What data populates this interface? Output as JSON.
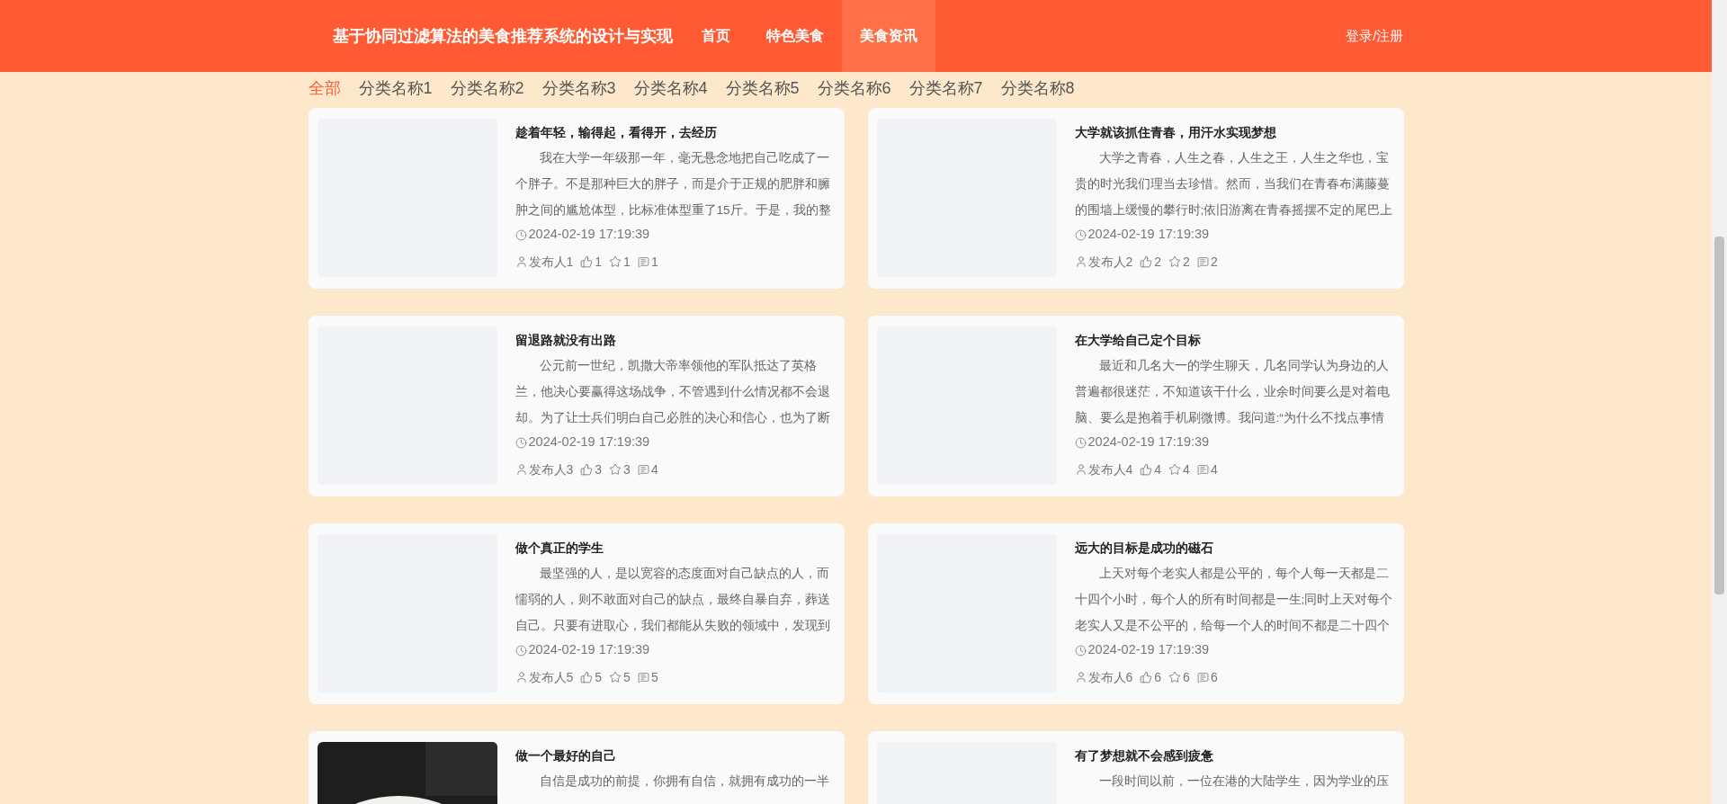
{
  "header": {
    "title": "基于协同过滤算法的美食推荐系统的设计与实现",
    "nav": [
      {
        "label": "首页",
        "selected": false
      },
      {
        "label": "特色美食",
        "selected": false
      },
      {
        "label": "美食资讯",
        "selected": true
      }
    ],
    "login": "登录/注册"
  },
  "categories": [
    {
      "label": "全部",
      "selected": true
    },
    {
      "label": "分类名称1",
      "selected": false
    },
    {
      "label": "分类名称2",
      "selected": false
    },
    {
      "label": "分类名称3",
      "selected": false
    },
    {
      "label": "分类名称4",
      "selected": false
    },
    {
      "label": "分类名称5",
      "selected": false
    },
    {
      "label": "分类名称6",
      "selected": false
    },
    {
      "label": "分类名称7",
      "selected": false
    },
    {
      "label": "分类名称8",
      "selected": false
    }
  ],
  "articles": [
    {
      "title": "趁着年轻，输得起，看得开，去经历",
      "summary": "我在大学一年级那一年，毫无悬念地把自己吃成了一个胖子。不是那种巨大的胖子，而是介于正规的肥胖和臃肿之间的尴尬体型，比标准体型重了15斤。于是，我的整",
      "date": "2024-02-19 17:19:39",
      "author": "发布人1",
      "likes": "1",
      "favorites": "1",
      "comments": "1",
      "has_photo": false
    },
    {
      "title": "大学就该抓住青春，用汗水实现梦想",
      "summary": "大学之青春，人生之春，人生之王，人生之华也，宝贵的时光我们理当去珍惜。然而，当我们在青春布满藤蔓的围墙上缓慢的攀行时;依旧游离在青春摇摆不定的尾巴上",
      "date": "2024-02-19 17:19:39",
      "author": "发布人2",
      "likes": "2",
      "favorites": "2",
      "comments": "2",
      "has_photo": false
    },
    {
      "title": "留退路就没有出路",
      "summary": "公元前一世纪，凯撒大帝率领他的军队抵达了英格兰，他决心要赢得这场战争，不管遇到什么情况都不会退却。为了让士兵们明白自己必胜的决心和信心，也为了断",
      "date": "2024-02-19 17:19:39",
      "author": "发布人3",
      "likes": "3",
      "favorites": "3",
      "comments": "4",
      "has_photo": false
    },
    {
      "title": "在大学给自己定个目标",
      "summary": "最近和几名大一的学生聊天，几名同学认为身边的人普遍都很迷茫，不知道该干什么，业余时间要么是对着电脑、要么是抱着手机刷微博。我问道:“为什么不找点事情",
      "date": "2024-02-19 17:19:39",
      "author": "发布人4",
      "likes": "4",
      "favorites": "4",
      "comments": "4",
      "has_photo": false
    },
    {
      "title": "做个真正的学生",
      "summary": "最坚强的人，是以宽容的态度面对自己缺点的人，而懦弱的人，则不敢面对自己的缺点，最终自暴自弃，葬送自己。只要有进取心，我们都能从失败的领域中，发现到",
      "date": "2024-02-19 17:19:39",
      "author": "发布人5",
      "likes": "5",
      "favorites": "5",
      "comments": "5",
      "has_photo": false
    },
    {
      "title": "远大的目标是成功的磁石",
      "summary": "上天对每个老实人都是公平的，每个人每一天都是二十四个小时，每个人的所有时间都是一生;同时上天对每个老实人又是不公平的，给每一个人的时间不都是二十四个",
      "date": "2024-02-19 17:19:39",
      "author": "发布人6",
      "likes": "6",
      "favorites": "6",
      "comments": "6",
      "has_photo": false
    },
    {
      "title": "做一个最好的自己",
      "summary": "自信是成功的前提，你拥有自信，就拥有成功的一半",
      "has_photo": true
    },
    {
      "title": "有了梦想就不会感到疲惫",
      "summary": "一段时间以前，一位在港的大陆学生，因为学业的压",
      "has_photo": false
    }
  ]
}
